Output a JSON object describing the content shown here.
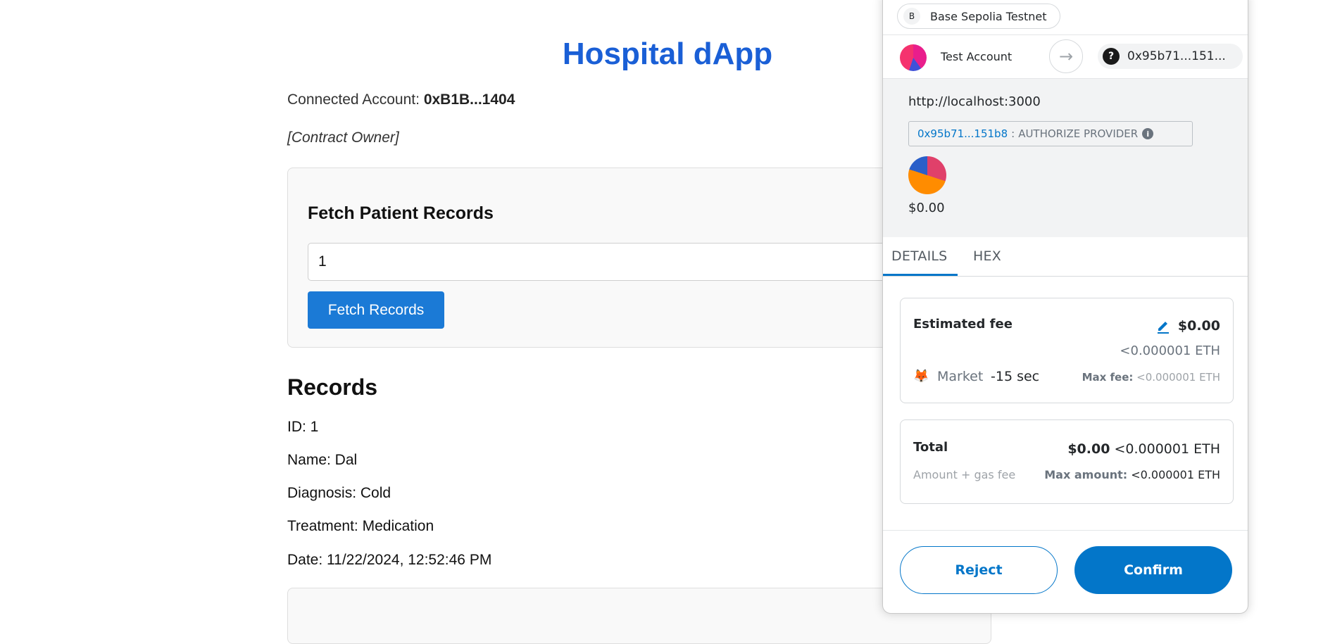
{
  "app": {
    "title": "Hospital dApp",
    "connected_label": "Connected Account:",
    "connected_address": "0xB1B...1404",
    "owner_tag": "[Contract Owner]"
  },
  "fetch": {
    "title": "Fetch Patient Records",
    "input_value": "1",
    "button_label": "Fetch Records"
  },
  "records": {
    "title": "Records",
    "lines": [
      "ID: 1",
      "Name: Dal",
      "Diagnosis: Cold",
      "Treatment: Medication",
      "Date: 11/22/2024, 12:52:46 PM"
    ]
  },
  "wallet": {
    "network_badge": "B",
    "network": "Base Sepolia Testnet",
    "account_name": "Test Account",
    "destination_address": "0x95b71...151...",
    "origin_url": "http://localhost:3000",
    "auth_address": "0x95b71...151b8",
    "auth_separator": ":",
    "auth_method": "AUTHORIZE PROVIDER",
    "origin_amount": "$0.00",
    "tabs": [
      "DETAILS",
      "HEX"
    ],
    "estimated_fee_label": "Estimated fee",
    "estimated_fee_fiat": "$0.00",
    "estimated_fee_eth": "<0.000001 ETH",
    "market_label": "Market",
    "market_time": "-15 sec",
    "max_fee_label": "Max fee:",
    "max_fee_value": "<0.000001 ETH",
    "total_label": "Total",
    "total_fiat": "$0.00",
    "total_eth": "<0.000001 ETH",
    "total_sub": "Amount + gas fee",
    "max_amount_label": "Max amount:",
    "max_amount_value": "<0.000001 ETH",
    "reject_label": "Reject",
    "confirm_label": "Confirm"
  },
  "colors": {
    "title_blue": "#1a5fd6",
    "button_blue": "#1b7ad6",
    "wallet_primary": "#0376c9"
  }
}
